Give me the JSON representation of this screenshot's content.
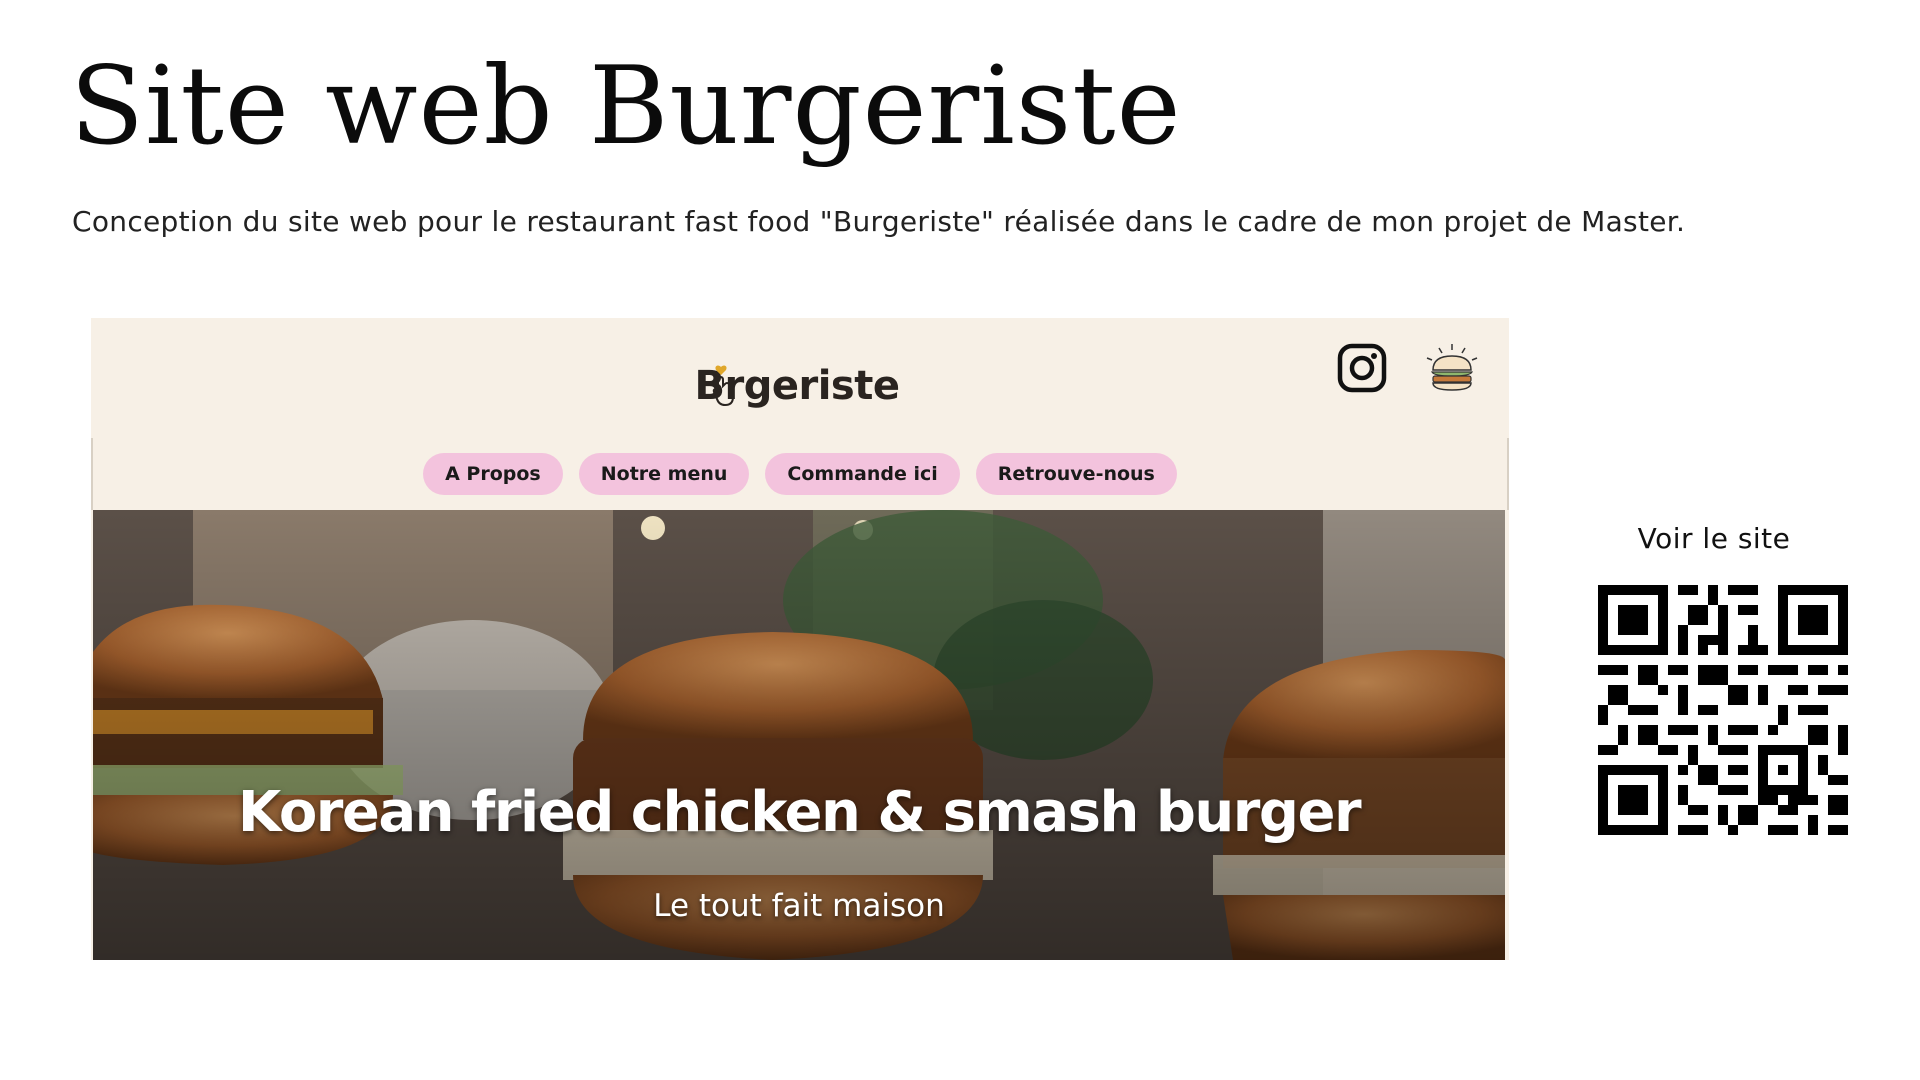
{
  "title": "Site web Burgeriste",
  "subtitle": "Conception du site web pour le restaurant fast food \"Burgeriste\" réalisée dans le cadre de mon projet de Master.",
  "website": {
    "logo_text": "Brgeriste",
    "header_icons": [
      "instagram-icon",
      "burger-icon"
    ],
    "nav": [
      "A Propos",
      "Notre menu",
      "Commande ici",
      "Retrouve-nous"
    ],
    "hero_title": "Korean fried chicken & smash burger",
    "hero_subtitle": "Le tout fait maison",
    "colors": {
      "background": "#f7f0e6",
      "nav_pill": "#f3c3dd",
      "logo_heart": "#e0a72a"
    }
  },
  "qr": {
    "label": "Voir le site",
    "icon": "qr-code-icon"
  }
}
